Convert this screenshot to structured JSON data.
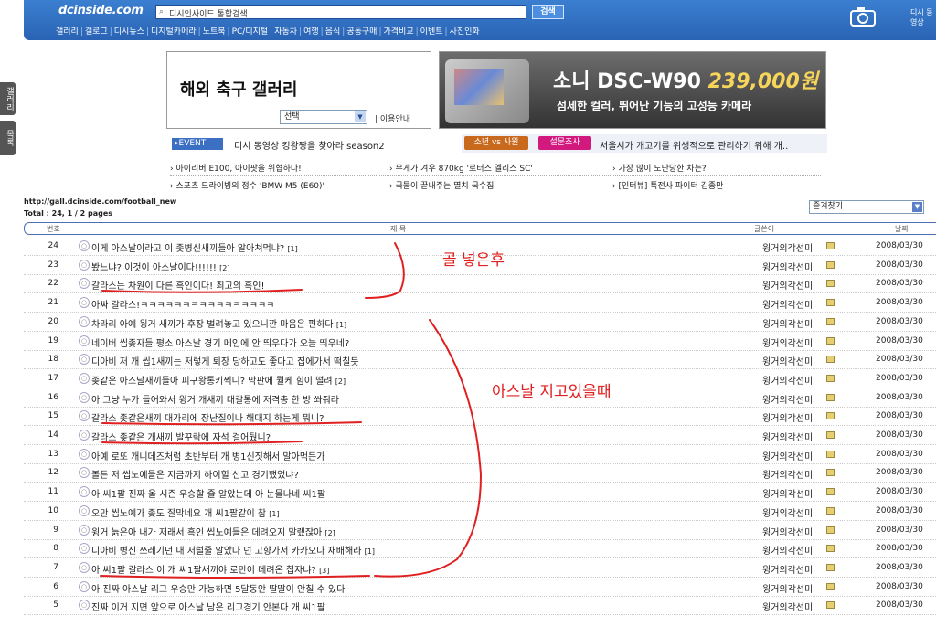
{
  "header": {
    "logo": "dcinside.com",
    "search_placeholder": "디시인사이드 통합검색",
    "search_button": "검색",
    "nav": [
      "갤러리",
      "갤로그",
      "디시뉴스",
      "디지털카메라",
      "노트북",
      "PC/디지털",
      "자동차",
      "여행",
      "음식",
      "공동구매",
      "가격비교",
      "이벤트",
      "사진인화"
    ],
    "tv_label": "디시 동영상"
  },
  "side_tabs": [
    "갤러리",
    "목록"
  ],
  "gallery": {
    "title": "해외 축구 갤러리",
    "select_value": "선택",
    "info": "이용안내"
  },
  "ad": {
    "title_prefix": "소니 DSC-W90",
    "price": "239,000원",
    "subtitle": "섬세한 컬러, 뛰어난 기능의 고성능 카메라"
  },
  "event": {
    "badge": "EVENT",
    "text": "디시 동영상 킹왕짱을 찾아라 season2",
    "badge2": "소년 vs 사원",
    "badge3": "설문조사",
    "text2": "서울시가 개고기를 위생적으로 관리하기 위해 개.."
  },
  "links_row1": [
    "아이리버 E100, 아이팟을 위협하다!",
    "무게가 겨우 870kg '로터스 엘리스 SC'",
    "가장 많이 도난당한 차는?"
  ],
  "links_row2": [
    "스포츠 드라이빙의 정수 'BMW M5 (E60)'",
    "국물이 끝내주는 멸치 국수집",
    "[인터뷰] 특전사 파이터 김종만"
  ],
  "list": {
    "url": "http://gall.dcinside.com/football_new",
    "total": "Total : 24, 1 / 2 pages",
    "favorites": "즐겨찾기",
    "columns": {
      "no": "번호",
      "title": "제 목",
      "author": "글쓴이",
      "date": "날짜"
    },
    "rows": [
      {
        "no": "24",
        "title": "이게 아스날이라고 이 좆병신새끼들아 알아쳐먹냐?",
        "comments": "[1]",
        "author": "윙거의각선미",
        "date": "2008/03/30"
      },
      {
        "no": "23",
        "title": "봤느냐? 이것이 아스날이다!!!!!!",
        "comments": "[2]",
        "author": "윙거의각선미",
        "date": "2008/03/30"
      },
      {
        "no": "22",
        "title": "갈라스는 차원이 다른 흑인이다! 최고의 흑인!",
        "comments": "",
        "author": "윙거의각선미",
        "date": "2008/03/30"
      },
      {
        "no": "21",
        "title": "아싸 갈라스!ㅋㅋㅋㅋㅋㅋㅋㅋㅋㅋㅋㅋㅋㅋㅋㅋ",
        "comments": "",
        "author": "윙거의각선미",
        "date": "2008/03/30"
      },
      {
        "no": "20",
        "title": "차라리 아예 윙거 새끼가 후장 벌려놓고 있으니깐 마음은 편하다",
        "comments": "[1]",
        "author": "윙거의각선미",
        "date": "2008/03/30"
      },
      {
        "no": "19",
        "title": "네이버 씹좆자들 평소 아스날 경기 메인에 안 띄우다가 오늘 띄우네?",
        "comments": "",
        "author": "윙거의각선미",
        "date": "2008/03/30"
      },
      {
        "no": "18",
        "title": "디아비 저 개 씹1새끼는 저렇게 퇴장 당하고도 좋다고 집에가서 떡칠듯",
        "comments": "",
        "author": "윙거의각선미",
        "date": "2008/03/30"
      },
      {
        "no": "17",
        "title": "좆같은 아스날새끼들아 피구왕통키찍니? 막판에 뭘케 힘이 떨려",
        "comments": "[2]",
        "author": "윙거의각선미",
        "date": "2008/03/30"
      },
      {
        "no": "16",
        "title": "아 그냥 누가 들어와서 윙거 개새끼 대갈통에 저격총 한 방 쏴줘라",
        "comments": "",
        "author": "윙거의각선미",
        "date": "2008/03/30"
      },
      {
        "no": "15",
        "title": "갈라스 좆같은새끼 대가리에 장난질이나 해대지 하는게 뭐니?",
        "comments": "",
        "author": "윙거의각선미",
        "date": "2008/03/30"
      },
      {
        "no": "14",
        "title": "갈라스 좆같은 개새끼 발꾸락에 자석 걸어뒀니?",
        "comments": "",
        "author": "윙거의각선미",
        "date": "2008/03/30"
      },
      {
        "no": "13",
        "title": "아예 로또 개니데즈처럼 초반부터 개 병1신짓해서 말아먹든가",
        "comments": "",
        "author": "윙거의각선미",
        "date": "2008/03/30"
      },
      {
        "no": "12",
        "title": "볼튼 저 씹노예들은 지금까지 하이힐 신고 경기했었냐?",
        "comments": "",
        "author": "윙거의각선미",
        "date": "2008/03/30"
      },
      {
        "no": "11",
        "title": "아 씨1팔 진짜 올 시즌 우승할 줄 알았는데 아 눈물나네 씨1팔",
        "comments": "",
        "author": "윙거의각선미",
        "date": "2008/03/30"
      },
      {
        "no": "10",
        "title": "오만 씹노예가 좆도 잘막네요 개 씨1팔같이 참",
        "comments": "[1]",
        "author": "윙거의각선미",
        "date": "2008/03/30"
      },
      {
        "no": "9",
        "title": "윙거 늙은아 내가 저래서 흑인 씹노예들은 데려오지 말랬잖아",
        "comments": "[2]",
        "author": "윙거의각선미",
        "date": "2008/03/30"
      },
      {
        "no": "8",
        "title": "디아비 병신 쓰레기년 내 저럴줄 알았다 넌 고향가서 카카오나 재배해라",
        "comments": "[1]",
        "author": "윙거의각선미",
        "date": "2008/03/30"
      },
      {
        "no": "7",
        "title": "아 씨1팔 갈라스 이 개 씨1팔새끼야 로만이 데려온 첩자냐?",
        "comments": "[3]",
        "author": "윙거의각선미",
        "date": "2008/03/30"
      },
      {
        "no": "6",
        "title": "아 진짜 아스날 리그 우승만 가능하면 5달동안 딸딸이 안칠 수 있다",
        "comments": "",
        "author": "윙거의각선미",
        "date": "2008/03/30"
      },
      {
        "no": "5",
        "title": "진짜 이거 지면 앞으로 아스날 남은 리그경기 안본다 개 씨1팔",
        "comments": "",
        "author": "윙거의각선미",
        "date": "2008/03/30"
      }
    ]
  },
  "annotations": {
    "top": "골 넣은후",
    "mid": "아스날 지고있을때"
  },
  "colors": {
    "topbar": "#2a63b4",
    "annotation": "#e02020"
  }
}
